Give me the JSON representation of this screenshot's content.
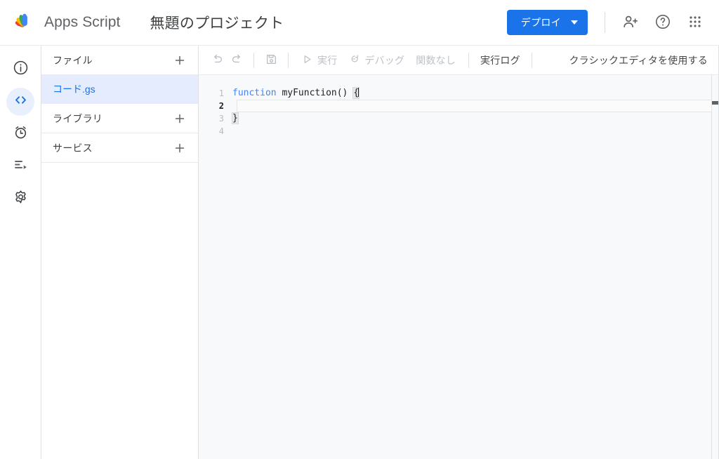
{
  "header": {
    "logo_icon": "apps-script-logo",
    "brand_name": "Apps Script",
    "project_title": "無題のプロジェクト",
    "deploy_label": "デプロイ",
    "deploy_caret_icon": "chevron-down-icon",
    "add_people_icon": "person-add-icon",
    "help_icon": "help-circle-icon",
    "apps_icon": "apps-grid-icon",
    "accent_color": "#1a73e8"
  },
  "rail": {
    "items": [
      {
        "name": "overview",
        "icon": "info-circle-icon",
        "active": false
      },
      {
        "name": "editor",
        "icon": "code-brackets-icon",
        "active": true
      },
      {
        "name": "triggers",
        "icon": "alarm-clock-icon",
        "active": false
      },
      {
        "name": "executions",
        "icon": "executions-list-icon",
        "active": false
      },
      {
        "name": "settings",
        "icon": "gear-icon",
        "active": false
      }
    ],
    "active_bg": "#e8f0fe",
    "active_fg": "#1a73e8"
  },
  "files_panel": {
    "files_header": {
      "label": "ファイル",
      "add_icon": "plus-icon"
    },
    "files": [
      {
        "label": "コード.gs",
        "selected": true
      }
    ],
    "libraries_header": {
      "label": "ライブラリ",
      "add_icon": "plus-icon"
    },
    "services_header": {
      "label": "サービス",
      "add_icon": "plus-icon"
    },
    "selected_bg": "#e4ecfd"
  },
  "editor_toolbar": {
    "undo_icon": "undo-icon",
    "redo_icon": "redo-icon",
    "save_icon": "save-floppy-icon",
    "run_icon": "play-triangle-icon",
    "run_label": "実行",
    "debug_icon": "debug-icon",
    "debug_label": "デバッグ",
    "function_select_label": "関数なし",
    "execution_log_label": "実行ログ",
    "classic_editor_label": "クラシックエディタを使用する"
  },
  "code_editor": {
    "language": "javascript",
    "active_line": 2,
    "lines": [
      {
        "number": "1",
        "tokens": [
          {
            "text": "function ",
            "type": "keyword"
          },
          {
            "text": "myFunction() ",
            "type": "plain"
          },
          {
            "text": "{",
            "type": "brace-match"
          }
        ]
      },
      {
        "number": "2",
        "tokens": []
      },
      {
        "number": "3",
        "tokens": [
          {
            "text": "}",
            "type": "brace-match"
          }
        ]
      },
      {
        "number": "4",
        "tokens": []
      }
    ],
    "keyword_color": "#4285f4",
    "text_color": "#202124",
    "background": "#f8f9fa"
  }
}
